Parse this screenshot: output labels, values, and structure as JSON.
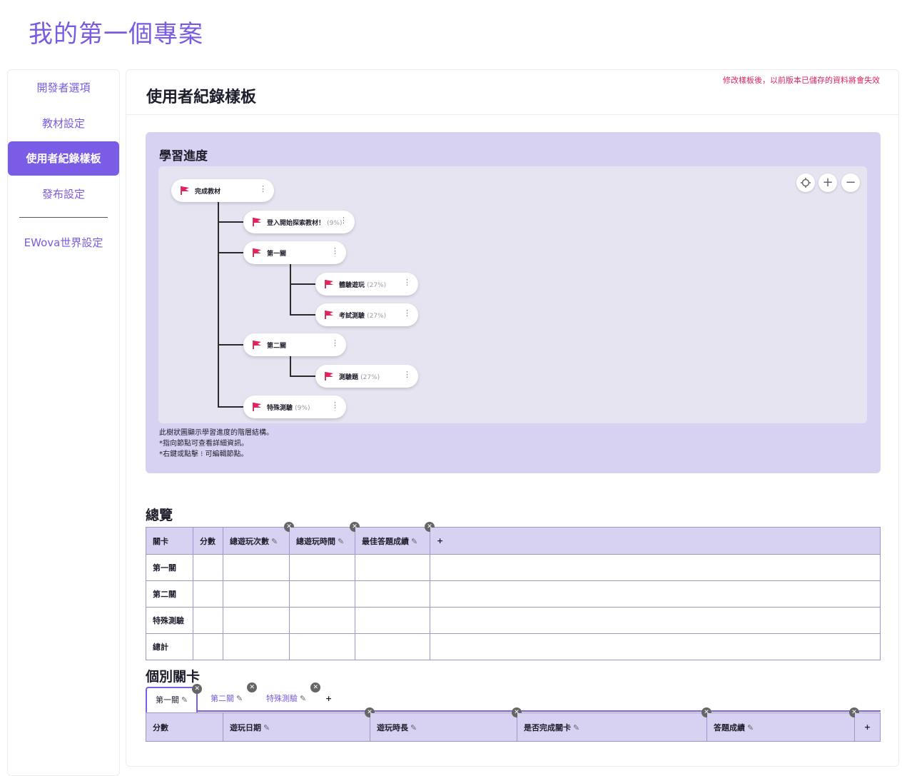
{
  "project_title": "我的第一個專案",
  "sidebar": {
    "items": [
      {
        "label": "開發者選項"
      },
      {
        "label": "教材設定"
      },
      {
        "label": "使用者紀錄樣板",
        "active": true
      },
      {
        "label": "發布設定"
      },
      {
        "label": "EWova世界設定"
      }
    ]
  },
  "main": {
    "title": "使用者紀錄樣板",
    "warning": "修改樣板後，以前版本已儲存的資料將會失效"
  },
  "progress": {
    "title": "學習進度",
    "zoom_controls": [
      "target-icon",
      "zoom-in-icon",
      "zoom-out-icon"
    ],
    "nodes": [
      {
        "label": "完成教材",
        "pct": ""
      },
      {
        "label": "登入開始探索教材！",
        "pct": "(9%)"
      },
      {
        "label": "第一關",
        "pct": ""
      },
      {
        "label": "體驗遊玩",
        "pct": "(27%)"
      },
      {
        "label": "考試測驗",
        "pct": "(27%)"
      },
      {
        "label": "第二關",
        "pct": ""
      },
      {
        "label": "測驗題",
        "pct": "(27%)"
      },
      {
        "label": "特殊測驗",
        "pct": "(9%)"
      }
    ],
    "notes": [
      "此樹狀圖顯示學習進度的階層結構。",
      "*指向節點可查看詳細資訊。",
      "*右鍵或點擊 ⁝ 可編輯節點。"
    ]
  },
  "overview": {
    "title": "總覽",
    "columns": [
      "關卡",
      "分數",
      "總遊玩次數",
      "總遊玩時間",
      "最佳答題成績",
      "+"
    ],
    "rows": [
      "第一關",
      "第二關",
      "特殊測驗",
      "總計"
    ]
  },
  "levels": {
    "title": "個別關卡",
    "tabs": [
      "第一關",
      "第二關",
      "特殊測驗",
      "+"
    ],
    "columns": [
      "分數",
      "遊玩日期",
      "遊玩時長",
      "是否完成關卡",
      "答題成績",
      "+"
    ]
  },
  "colors": {
    "accent": "#7b5ce6",
    "panel": "#d8d2f2",
    "warning": "#e0245e",
    "flag": "#e0245e"
  }
}
